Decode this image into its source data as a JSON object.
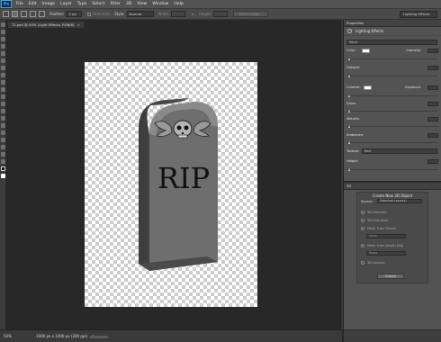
{
  "app": {
    "logo": "Ps"
  },
  "menu": [
    "File",
    "Edit",
    "Image",
    "Layer",
    "Type",
    "Select",
    "Filter",
    "3D",
    "View",
    "Window",
    "Help"
  ],
  "options": {
    "feather_label": "Feather:",
    "feather_value": "0 px",
    "antialias_label": "Anti-alias",
    "style_label": "Style:",
    "style_value": "Normal",
    "width_label": "Width:",
    "height_label": "Height:",
    "refine_label": "Refine Edge...",
    "workspace": "Lighting Effects"
  },
  "document": {
    "tab_title": "T1.psd @ 50% (Light Effects, RGB/8)",
    "close": "×",
    "zoom": "50%",
    "info": "1000 px x 1400 px (200 ppi)",
    "tombstone_text": "RIP"
  },
  "properties": {
    "tab": "Properties",
    "title": "Lighting Effects",
    "light_type": "Point",
    "color_label": "Color:",
    "intensity_label": "Intensity:",
    "hotspot_label": "Hotspot:",
    "colorize_label": "Colorize:",
    "exposure_label": "Exposure:",
    "gloss_label": "Gloss:",
    "metallic_label": "Metallic:",
    "ambience_label": "Ambience:",
    "texture_label": "Texture:",
    "texture_value": "Red",
    "height_label": "Height:"
  },
  "panel3d": {
    "tab": "3D",
    "title": "Create New 3D Object",
    "source_label": "Source:",
    "source_value": "Selected Layer(s)",
    "options": [
      {
        "label": "3D Postcard",
        "selected": false
      },
      {
        "label": "3D Extrusion",
        "selected": false
      },
      {
        "label": "Mesh From Preset",
        "selected": false
      },
      {
        "label": "Mesh From Depth Map",
        "selected": false
      },
      {
        "label": "3D Volume",
        "selected": false
      }
    ],
    "preset_value": "Cone",
    "depth_value": "Plane",
    "create_label": "Create"
  },
  "colors": {
    "menu_bg": "#535353",
    "canvas_bg": "#282828",
    "panel_bg": "#535353",
    "stone": "#6e6e6e",
    "text_dark": "#111111"
  }
}
